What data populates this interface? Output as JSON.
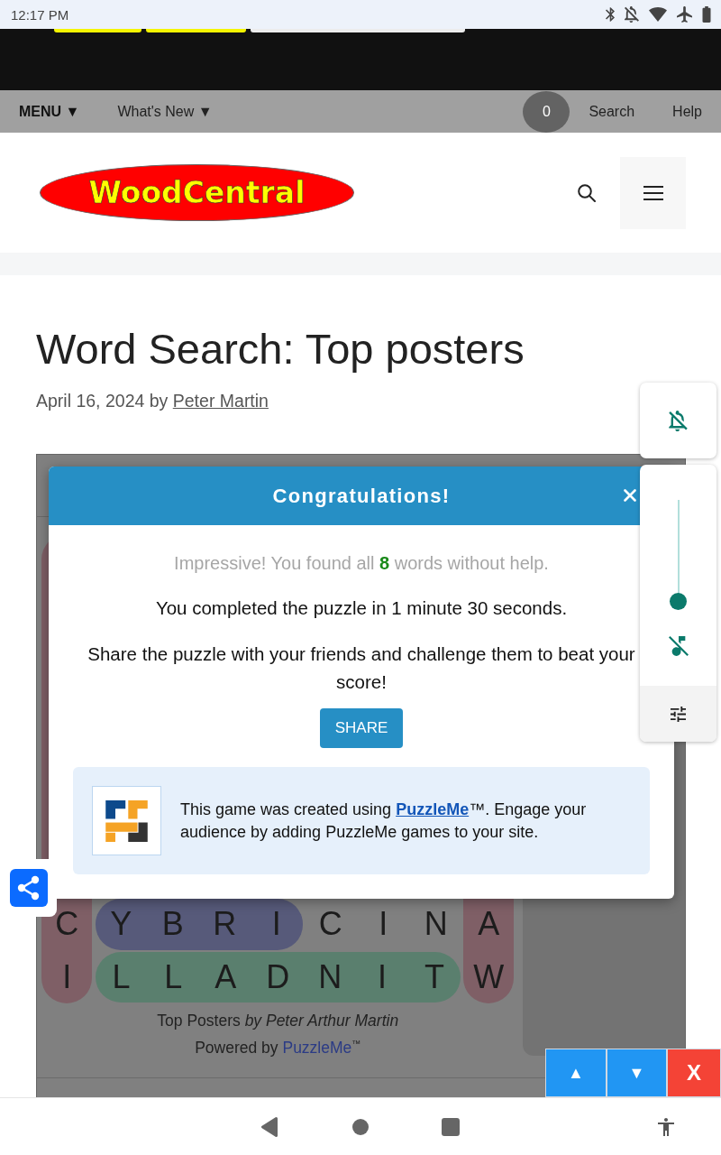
{
  "status_bar": {
    "time": "12:17 PM"
  },
  "top_menu": {
    "items": [
      {
        "label": "MENU ▼",
        "kind": "main"
      },
      {
        "label": "What's New ▼",
        "kind": "dropdown"
      }
    ],
    "badge": "0",
    "links": [
      {
        "label": "Search"
      },
      {
        "label": "Help"
      }
    ]
  },
  "header": {
    "logo": "WoodCentral"
  },
  "article": {
    "title": "Word Search: Top posters",
    "byline": {
      "text": "April 16, 2024 by ",
      "author": "Peter Martin"
    }
  },
  "puzzle": {
    "grid": {
      "vertical_words": [
        {
          "kind": "left",
          "color": "#7f5f66",
          "letters": [
            "C",
            "I"
          ]
        },
        {
          "kind": "right",
          "color": "#7f5f66",
          "letters": [
            "A",
            "W"
          ]
        }
      ],
      "rows": [
        {
          "segments": [
            {
              "kind": "word",
              "color": "#575a7a",
              "letters": [
                "Y",
                "B",
                "R",
                "I"
              ]
            },
            {
              "kind": "plain",
              "letters": [
                "C",
                "I",
                "N"
              ]
            }
          ]
        },
        {
          "segments": [
            {
              "kind": "word",
              "color": "#5a7f6e",
              "letters": [
                "L",
                "L",
                "A",
                "D",
                "N",
                "I",
                "T"
              ]
            }
          ]
        }
      ]
    },
    "caption": "Top Posters *by Peter Arthur Martin*",
    "powered_by": {
      "text": "Powered by ",
      "link": "PuzzleMe",
      "suffix": "$^{™}$"
    }
  },
  "dialog": {
    "title": "Congratulations!",
    "summary": "Impressive! You found all **8** words without help.",
    "time_text": "You completed the puzzle in 1 minute 30 seconds.",
    "share_text": "Share the puzzle with your friends and challenge them to beat your score!",
    "share_button": "SHARE",
    "promo": {
      "before": "This game was created using ",
      "link": "PuzzleMe",
      "after": "™. Engage your audience by adding PuzzleMe games to your site."
    }
  },
  "volume_panel": {
    "ringer_muted": true,
    "level": 0,
    "media_muted": true
  },
  "scroll_buttons": [
    {
      "label": "▲",
      "kind": "up"
    },
    {
      "label": "▼",
      "kind": "down"
    },
    {
      "label": "X",
      "kind": "close"
    }
  ]
}
